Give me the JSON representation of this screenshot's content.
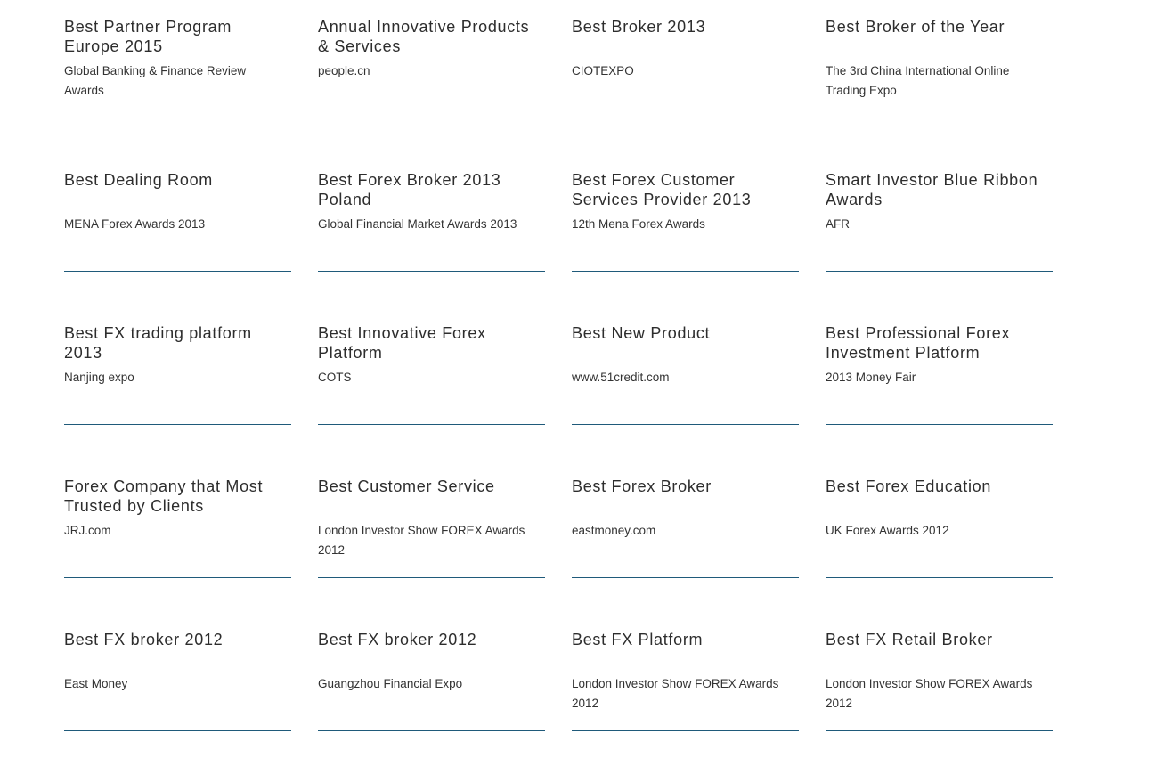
{
  "awards": [
    {
      "title": "Best Partner Program Europe 2015",
      "source": "Global Banking & Finance Review Awards"
    },
    {
      "title": "Annual Innovative Products & Services",
      "source": "people.cn"
    },
    {
      "title": "Best Broker 2013",
      "source": "CIOTEXPO"
    },
    {
      "title": "Best Broker of the Year",
      "source": "The 3rd China International Online Trading Expo"
    },
    {
      "title": "Best Dealing Room",
      "source": "MENA Forex Awards 2013"
    },
    {
      "title": "Best Forex Broker 2013 Poland",
      "source": "Global Financial Market Awards 2013"
    },
    {
      "title": "Best Forex Customer Services Provider 2013",
      "source": "12th Mena Forex Awards"
    },
    {
      "title": "Smart Investor Blue Ribbon Awards",
      "source": "AFR"
    },
    {
      "title": "Best FX trading platform 2013",
      "source": "Nanjing expo"
    },
    {
      "title": "Best Innovative Forex Platform",
      "source": "COTS"
    },
    {
      "title": "Best New Product",
      "source": "www.51credit.com"
    },
    {
      "title": "Best Professional Forex Investment Platform",
      "source": "2013 Money Fair"
    },
    {
      "title": "Forex Company that Most Trusted by Clients",
      "source": "JRJ.com"
    },
    {
      "title": "Best Customer Service",
      "source": "London Investor Show FOREX Awards 2012"
    },
    {
      "title": "Best Forex Broker",
      "source": "eastmoney.com"
    },
    {
      "title": "Best Forex Education",
      "source": "UK Forex Awards 2012"
    },
    {
      "title": "Best FX broker 2012",
      "source": "East Money"
    },
    {
      "title": "Best FX broker 2012",
      "source": "Guangzhou Financial Expo"
    },
    {
      "title": "Best FX Platform",
      "source": "London Investor Show FOREX Awards 2012"
    },
    {
      "title": "Best FX Retail Broker",
      "source": "London Investor Show FOREX Awards 2012"
    }
  ]
}
